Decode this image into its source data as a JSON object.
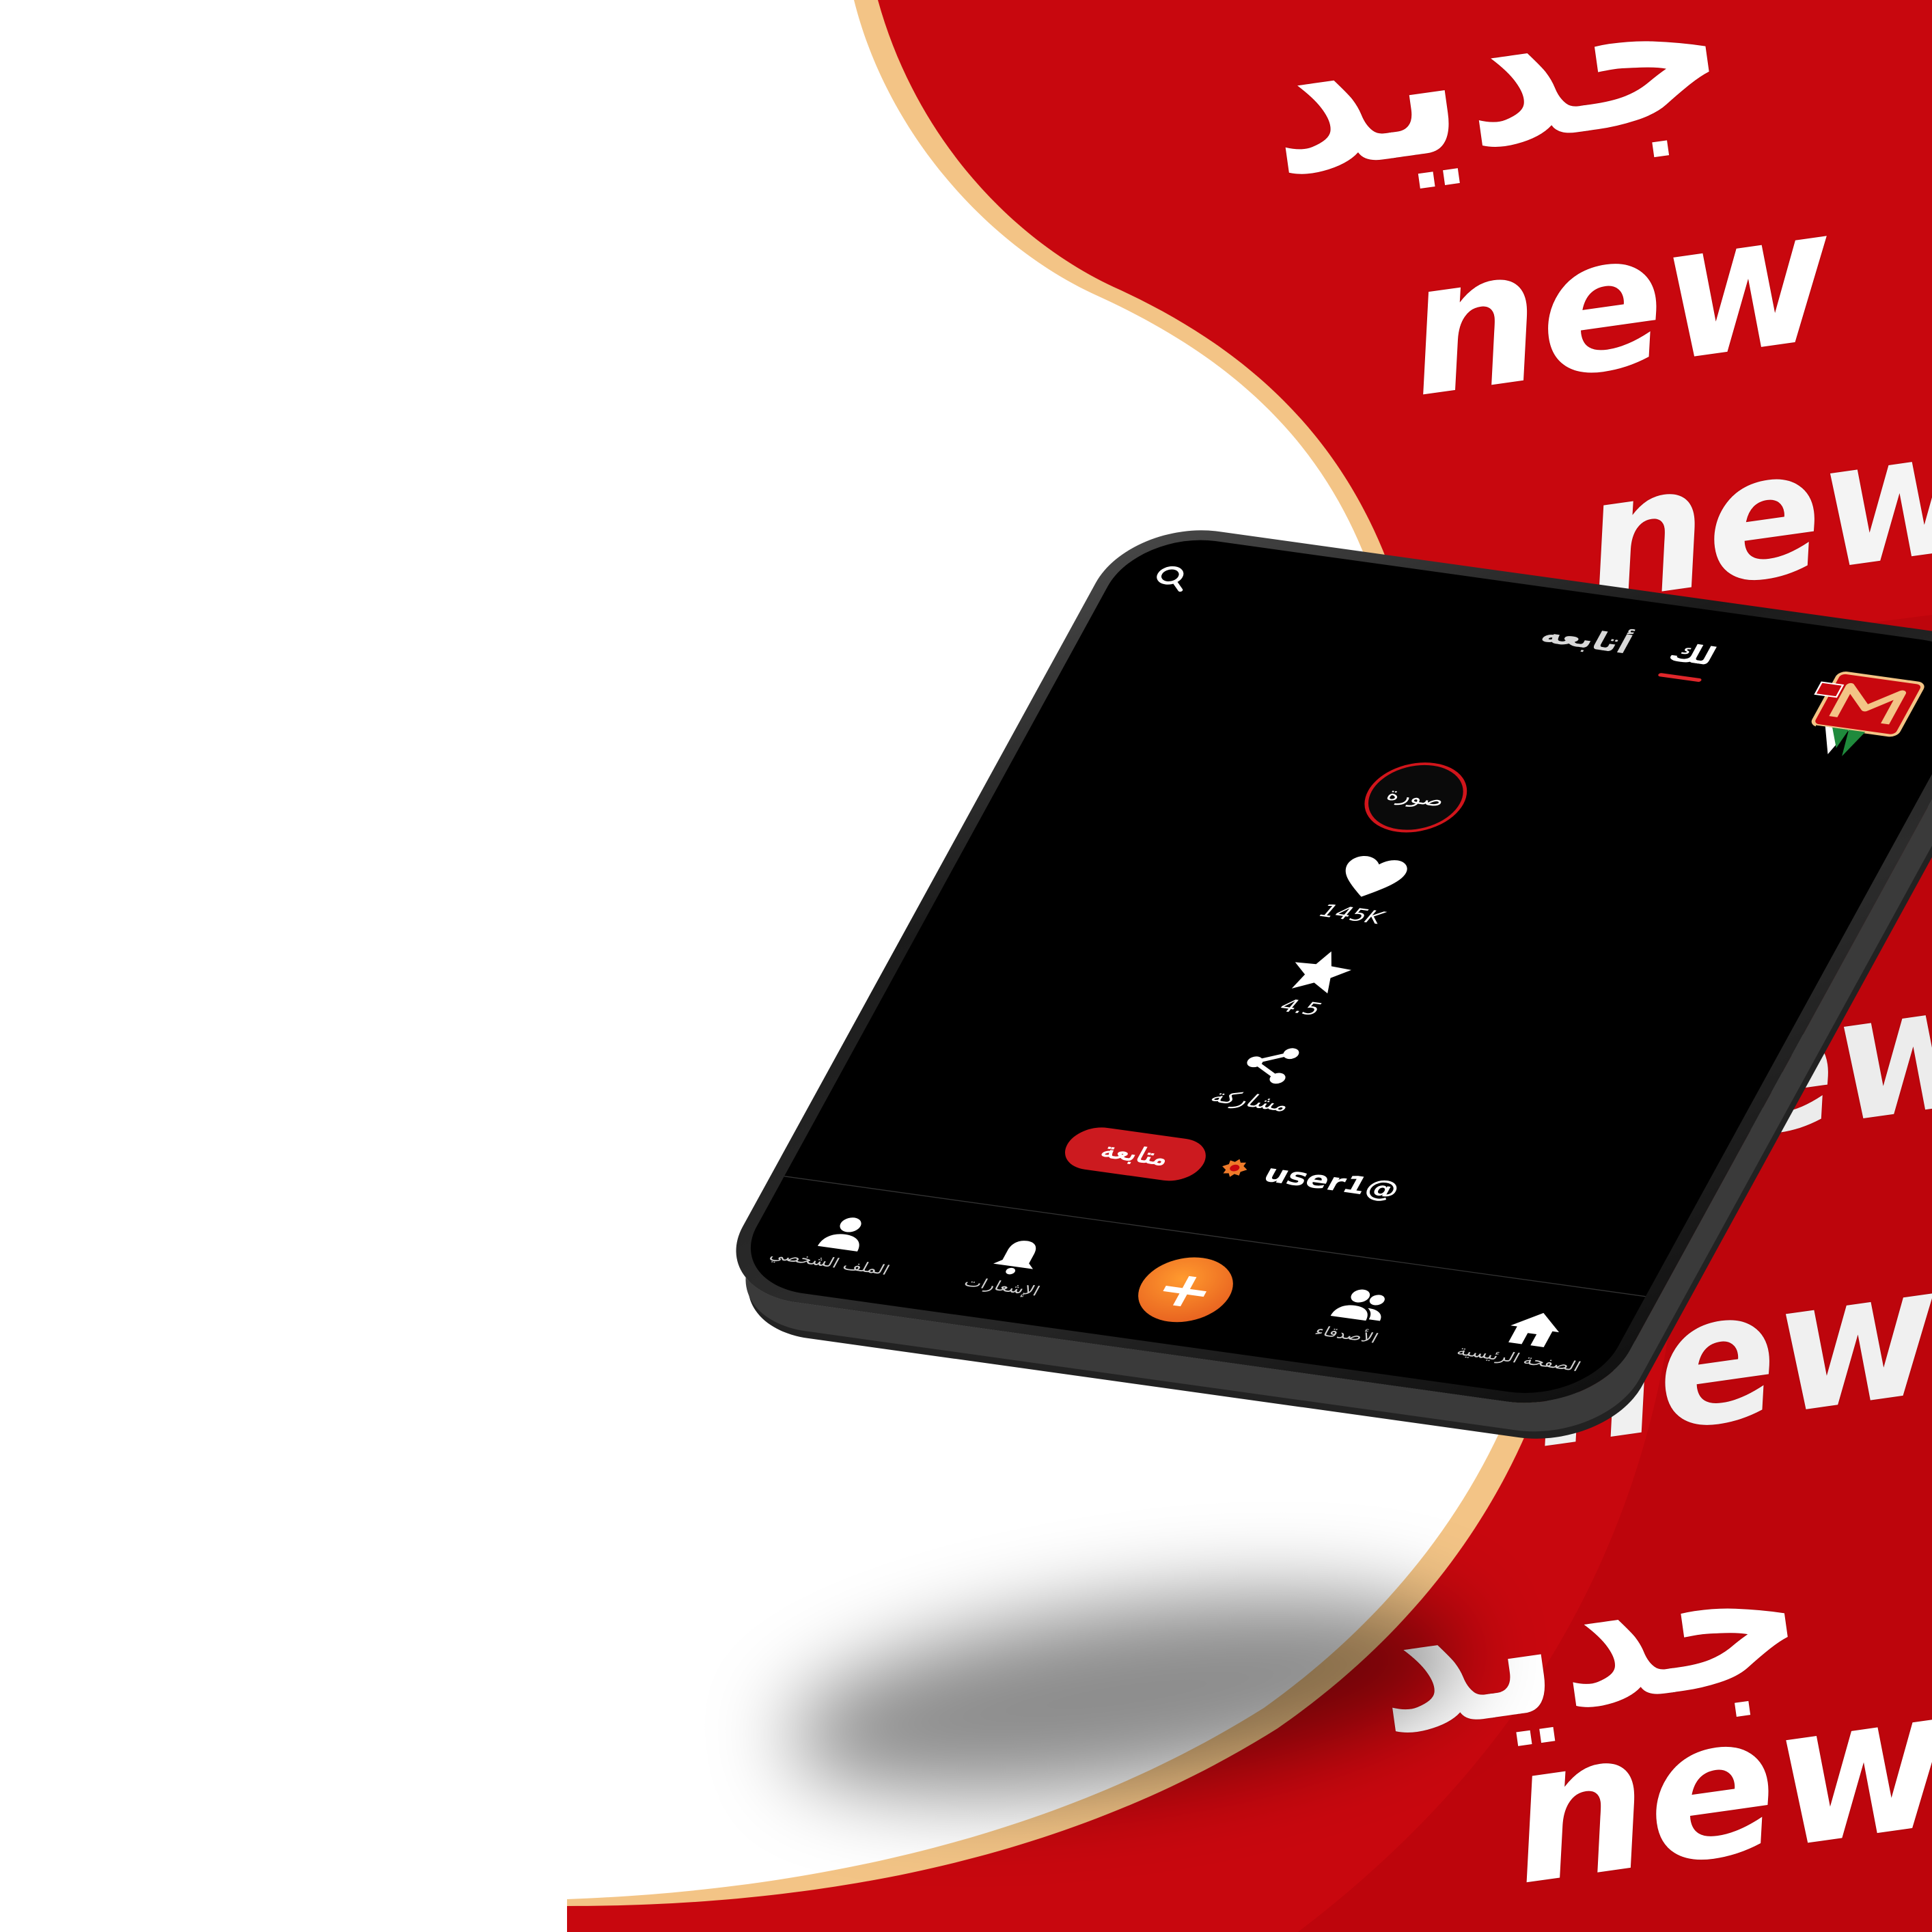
{
  "poster": {
    "words": [
      "جديد",
      "new",
      "new",
      "new",
      "new",
      "new",
      "جديد",
      "new"
    ]
  },
  "colors": {
    "brand_red": "#c8070e",
    "accent_orange": "#ee7a2a",
    "cream_stripe": "#f3c486",
    "screen_bg": "#000000",
    "follow_red": "#cc1a1f"
  },
  "app": {
    "tabs": [
      {
        "label": "لك",
        "active": true
      },
      {
        "label": "أتابعه",
        "active": false
      }
    ],
    "search_icon": "search-icon",
    "actions": {
      "avatar_text": "صورة",
      "likes": "145K",
      "rating": "4.5",
      "share": "مشاركة"
    },
    "user": {
      "handle": "user1@",
      "follow_label": "متابعة"
    },
    "nav": [
      {
        "label": "الملف الشخصي",
        "icon": "person-icon"
      },
      {
        "label": "الإشعارات",
        "icon": "bell-icon"
      },
      {
        "label": "+",
        "icon": "plus-icon"
      },
      {
        "label": "الأصدقاء",
        "icon": "friends-icon"
      },
      {
        "label": "الصفحة الرئيسية",
        "icon": "home-icon"
      }
    ]
  }
}
